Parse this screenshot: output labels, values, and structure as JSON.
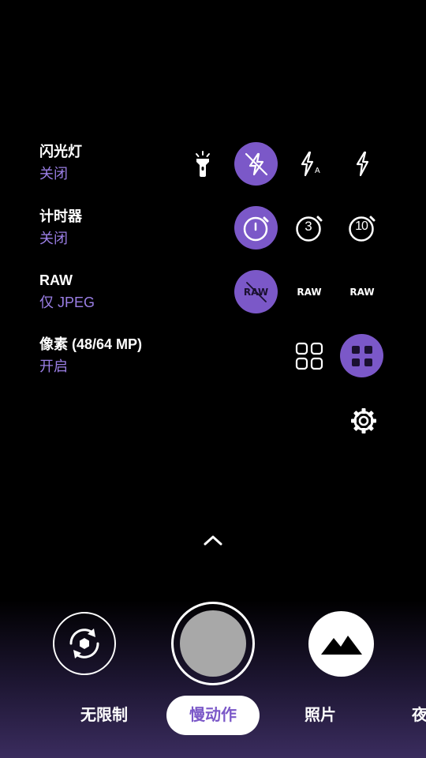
{
  "settings_rows": [
    {
      "title": "闪光灯",
      "value": "关闭"
    },
    {
      "title": "计时器",
      "value": "关闭"
    },
    {
      "title": "RAW",
      "value": "仅 JPEG"
    },
    {
      "title": "像素 (48/64 MP)",
      "value": "开启"
    }
  ],
  "raw_options": {
    "raw_off": "RAW",
    "raw_on": "RAW",
    "raw_jpeg": "RAW"
  },
  "timer_options": {
    "three": "3",
    "ten": "10"
  },
  "flash_auto_mark": "A",
  "modes": [
    "无限制",
    "慢动作",
    "照片",
    "夜"
  ],
  "active_mode": "慢动作",
  "colors": {
    "accent": "#7b58c8",
    "value_text": "#9b7fe6",
    "shutter_fill": "#a8a8a8"
  },
  "icons": {
    "flash": [
      "flashlight-icon",
      "flash-off-icon",
      "flash-auto-icon",
      "flash-on-icon"
    ],
    "timer": [
      "timer-off-icon",
      "timer-3s-icon",
      "timer-10s-icon"
    ],
    "raw": [
      "raw-off-icon",
      "raw-icon",
      "raw-plus-jpeg-icon"
    ],
    "pixel": [
      "pixel-binning-small-icon",
      "pixel-binning-large-icon"
    ],
    "other": [
      "settings-gear-icon",
      "chevron-up-icon",
      "switch-camera-icon",
      "gallery-icon"
    ]
  }
}
